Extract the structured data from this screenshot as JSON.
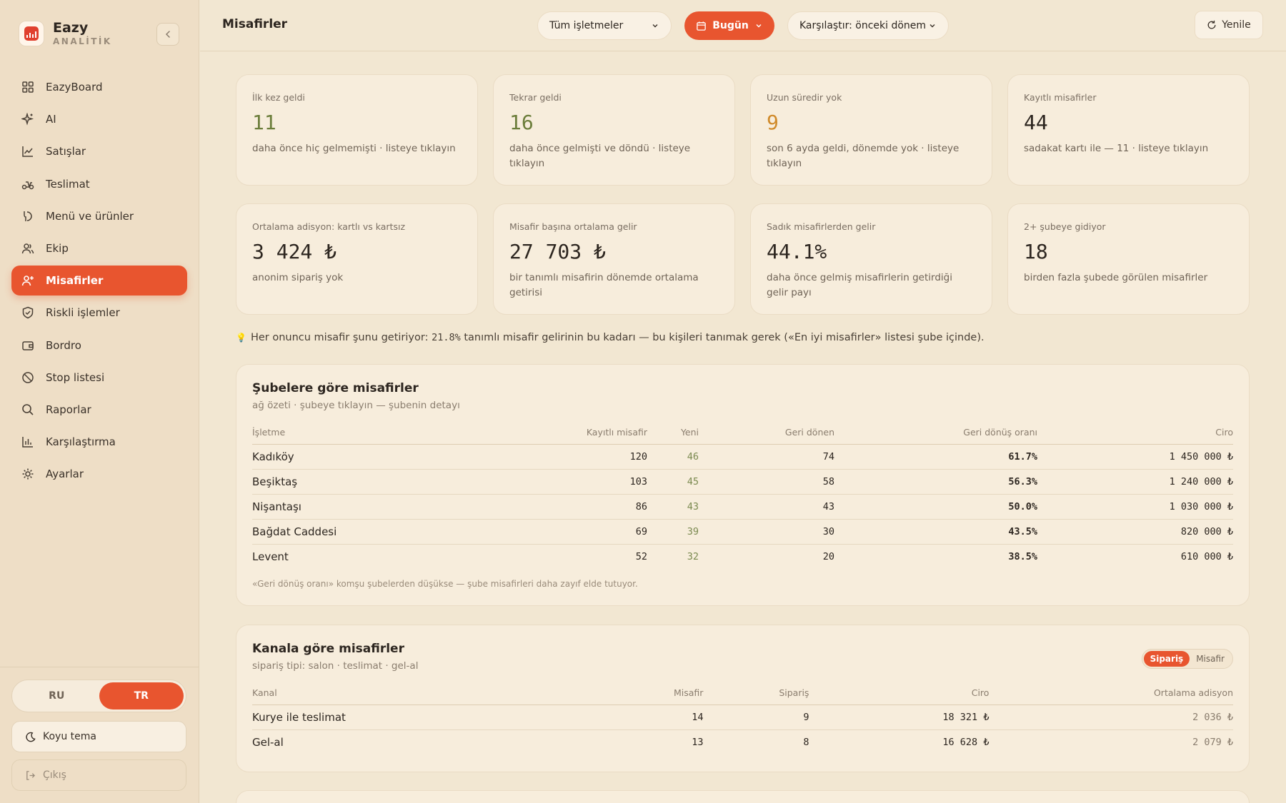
{
  "brand": {
    "name": "Eazy",
    "sub": "ANALİTİK"
  },
  "nav": [
    {
      "label": "EazyBoard",
      "icon": "grid-icon"
    },
    {
      "label": "AI",
      "icon": "sparkle-icon"
    },
    {
      "label": "Satışlar",
      "icon": "chart-line-icon"
    },
    {
      "label": "Teslimat",
      "icon": "scooter-icon"
    },
    {
      "label": "Menü ve ürünler",
      "icon": "dish-icon"
    },
    {
      "label": "Ekip",
      "icon": "users-icon"
    },
    {
      "label": "Misafirler",
      "icon": "user-plus-icon",
      "active": true
    },
    {
      "label": "Riskli işlemler",
      "icon": "shield-icon"
    },
    {
      "label": "Bordro",
      "icon": "wallet-icon"
    },
    {
      "label": "Stop listesi",
      "icon": "ban-icon"
    },
    {
      "label": "Raporlar",
      "icon": "search-icon"
    },
    {
      "label": "Karşılaştırma",
      "icon": "bar-chart-icon"
    },
    {
      "label": "Ayarlar",
      "icon": "gear-icon"
    }
  ],
  "lang": {
    "ru": "RU",
    "tr": "TR",
    "active": "TR"
  },
  "theme_label": "Koyu tema",
  "logout_label": "Çıkış",
  "header": {
    "title": "Misafirler",
    "venue_select": "Tüm işletmeler",
    "period": "Bugün",
    "compare": "Karşılaştır: önceki dönem",
    "refresh": "Yenile"
  },
  "stats_row1": [
    {
      "label": "İlk kez geldi",
      "value": "11",
      "desc": "daha önce hiç gelmemişti · listeye tıklayın",
      "tone": "green"
    },
    {
      "label": "Tekrar geldi",
      "value": "16",
      "desc": "daha önce gelmişti ve döndü · listeye tıklayın",
      "tone": "green"
    },
    {
      "label": "Uzun süredir yok",
      "value": "9",
      "desc": "son 6 ayda geldi, dönemde yok · listeye tıklayın",
      "tone": "amber"
    },
    {
      "label": "Kayıtlı misafirler",
      "value": "44",
      "desc": "sadakat kartı ile — 11 · listeye tıklayın",
      "tone": "dark"
    }
  ],
  "stats_row2": [
    {
      "label": "Ortalama adisyon: kartlı vs kartsız",
      "value": "3 424 ₺",
      "desc": "anonim sipariş yok"
    },
    {
      "label": "Misafir başına ortalama gelir",
      "value": "27 703 ₺",
      "desc": "bir tanımlı misafirin dönemde ortalama getirisi"
    },
    {
      "label": "Sadık misafirlerden gelir",
      "value": "44.1%",
      "desc": "daha önce gelmiş misafirlerin getirdiği gelir payı"
    },
    {
      "label": "2+ şubeye gidiyor",
      "value": "18",
      "desc": "birden fazla şubede görülen misafirler"
    }
  ],
  "tip": {
    "icon": "💡",
    "before": "Her onuncu misafir şunu getiriyor: ",
    "value": "21.8%",
    "after": " tanımlı misafir gelirinin bu kadarı — bu kişileri tanımak gerek («En iyi misafirler» listesi şube içinde)."
  },
  "branches": {
    "title": "Şubelere göre misafirler",
    "subtitle": "ağ özeti · şubeye tıklayın — şubenin detayı",
    "columns": [
      "İşletme",
      "Kayıtlı misafir",
      "Yeni",
      "Geri dönen",
      "Geri dönüş oranı",
      "Ciro"
    ],
    "rows": [
      [
        "Kadıköy",
        "120",
        "46",
        "74",
        "61.7%",
        "1 450 000 ₺"
      ],
      [
        "Beşiktaş",
        "103",
        "45",
        "58",
        "56.3%",
        "1 240 000 ₺"
      ],
      [
        "Nişantaşı",
        "86",
        "43",
        "43",
        "50.0%",
        "1 030 000 ₺"
      ],
      [
        "Bağdat Caddesi",
        "69",
        "39",
        "30",
        "43.5%",
        "820 000 ₺"
      ],
      [
        "Levent",
        "52",
        "32",
        "20",
        "38.5%",
        "610 000 ₺"
      ]
    ],
    "note": "«Geri dönüş oranı» komşu şubelerden düşükse — şube misafirleri daha zayıf elde tutuyor."
  },
  "channels": {
    "title": "Kanala göre misafirler",
    "subtitle": "sipariş tipi: salon · teslimat · gel-al",
    "toggle": [
      "Sipariş",
      "Misafir"
    ],
    "columns": [
      "Kanal",
      "Misafir",
      "Sipariş",
      "Ciro",
      "Ortalama adisyon"
    ],
    "rows": [
      [
        "Kurye ile teslimat",
        "14",
        "9",
        "18 321 ₺",
        "2 036 ₺"
      ],
      [
        "Gel-al",
        "13",
        "8",
        "16 628 ₺",
        "2 079 ₺"
      ]
    ]
  },
  "colors": {
    "accent": "#e8552f",
    "green": "#6b7d3a",
    "amber": "#d08a2a"
  }
}
